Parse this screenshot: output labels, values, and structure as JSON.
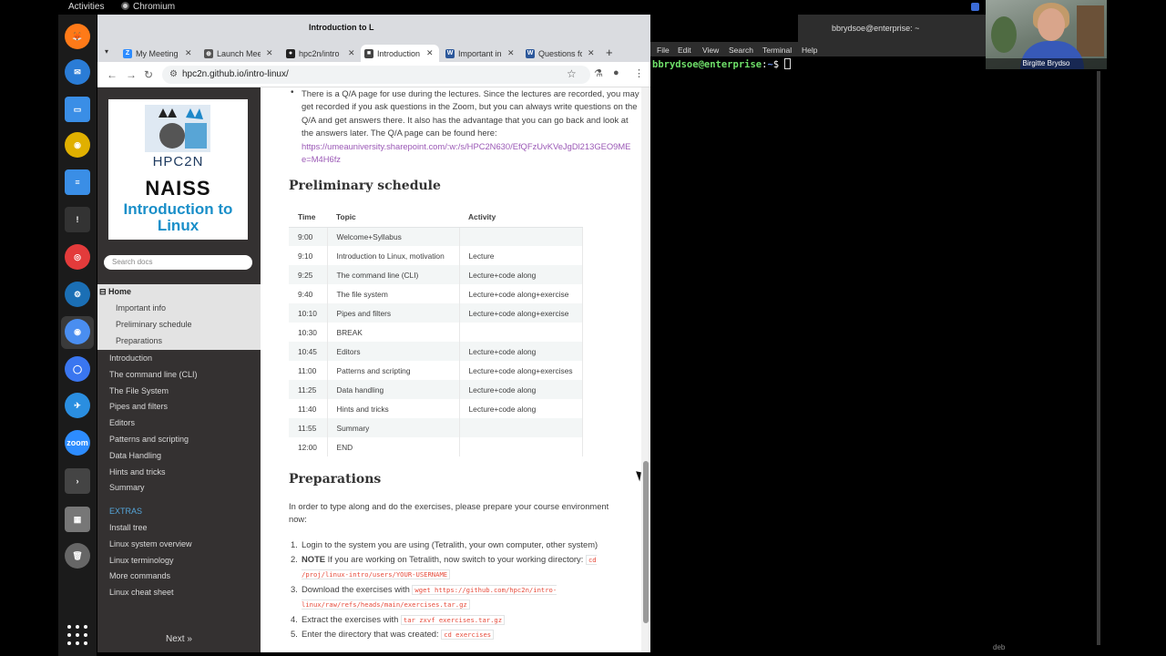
{
  "topbar": {
    "activities": "Activities",
    "app": "Chromium"
  },
  "dock": {
    "items": [
      {
        "name": "firefox-icon",
        "glyph": "🦊",
        "color": "#ff7a18"
      },
      {
        "name": "thunderbird-icon",
        "glyph": "✉",
        "color": "#2a7cd6"
      },
      {
        "name": "text-editor-icon",
        "glyph": "▭",
        "color": "#3a8ee6"
      },
      {
        "name": "rhythmbox-icon",
        "glyph": "◉",
        "color": "#e0b000"
      },
      {
        "name": "writer-icon",
        "glyph": "≡",
        "color": "#3a8ee6"
      },
      {
        "name": "unknown-app-icon",
        "glyph": "!",
        "color": "#333333"
      },
      {
        "name": "help-lifebuoy-icon",
        "glyph": "◎",
        "color": "#e33b3b"
      },
      {
        "name": "steam-icon",
        "glyph": "⚙",
        "color": "#1b6fb5"
      },
      {
        "name": "chromium-icon",
        "glyph": "◉",
        "color": "#4a8ef0"
      },
      {
        "name": "signal-icon",
        "glyph": "◯",
        "color": "#3a76f0"
      },
      {
        "name": "thunderbird-alt-icon",
        "glyph": "✈",
        "color": "#2a8ee0"
      },
      {
        "name": "zoom-icon",
        "glyph": "zoom",
        "color": "#2d8cff"
      },
      {
        "name": "terminal-icon",
        "glyph": "›",
        "color": "#444444"
      },
      {
        "name": "disk-icon",
        "glyph": "▦",
        "color": "#777777"
      },
      {
        "name": "trash-icon",
        "glyph": "🗑",
        "color": "#666666"
      }
    ]
  },
  "browser": {
    "window_title": "Introduction to L",
    "tabs": [
      {
        "label": "My Meeting",
        "icon_color": "#2d8cff",
        "icon": "Z"
      },
      {
        "label": "Launch Mee",
        "icon_color": "#555555",
        "icon": "⊕"
      },
      {
        "label": "hpc2n/intro",
        "icon_color": "#222222",
        "icon": "●"
      },
      {
        "label": "Introduction",
        "icon_color": "#444444",
        "icon": "■"
      },
      {
        "label": "Important in",
        "icon_color": "#2b579a",
        "icon": "W"
      },
      {
        "label": "Questions fo",
        "icon_color": "#2b579a",
        "icon": "W"
      }
    ],
    "url": "hpc2n.github.io/intro-linux/",
    "new_tab": "+"
  },
  "sidebar": {
    "logo": {
      "line1": "HPC2N",
      "line2": "NAISS",
      "line3": "Introduction to Linux"
    },
    "search_placeholder": "Search docs",
    "home": "Home",
    "home_subitems": [
      "Important info",
      "Preliminary schedule",
      "Preparations"
    ],
    "links": [
      "Introduction",
      "The command line (CLI)",
      "The File System",
      "Pipes and filters",
      "Editors",
      "Patterns and scripting",
      "Data Handling",
      "Hints and tricks",
      "Summary"
    ],
    "extras_caption": "EXTRAS",
    "extras": [
      "Install tree",
      "Linux system overview",
      "Linux terminology",
      "More commands",
      "Linux cheat sheet"
    ],
    "next": "Next »"
  },
  "content": {
    "qa_text": "There is a Q/A page for use during the lectures. Since the lectures are recorded, you may get recorded if you ask questions in the Zoom, but you can always write questions on the Q/A and get answers there. It also has the advantage that you can go back and look at the answers later. The Q/A page can be found here:",
    "qa_link": "https://umeauniversity.sharepoint.com/:w:/s/HPC2N630/EfQFzUvKVeJgDl213GEO9ME e=M4H6fz",
    "schedule_title": "Preliminary schedule",
    "schedule_headers": [
      "Time",
      "Topic",
      "Activity"
    ],
    "schedule_rows": [
      [
        "9:00",
        "Welcome+Syllabus",
        ""
      ],
      [
        "9:10",
        "Introduction to Linux, motivation",
        "Lecture"
      ],
      [
        "9:25",
        "The command line (CLI)",
        "Lecture+code along"
      ],
      [
        "9:40",
        "The file system",
        "Lecture+code along+exercise"
      ],
      [
        "10:10",
        "Pipes and filters",
        "Lecture+code along+exercise"
      ],
      [
        "10:30",
        "BREAK",
        ""
      ],
      [
        "10:45",
        "Editors",
        "Lecture+code along"
      ],
      [
        "11:00",
        "Patterns and scripting",
        "Lecture+code along+exercises"
      ],
      [
        "11:25",
        "Data handling",
        "Lecture+code along"
      ],
      [
        "11:40",
        "Hints and tricks",
        "Lecture+code along"
      ],
      [
        "11:55",
        "Summary",
        ""
      ],
      [
        "12:00",
        "END",
        ""
      ]
    ],
    "prep_title": "Preparations",
    "prep_intro": "In order to type along and do the exercises, please prepare your course environment now:",
    "steps": [
      {
        "num": "1.",
        "text": "Login to the system you are using (Tetralith, your own computer, other system)",
        "code": ""
      },
      {
        "num": "2.",
        "bold": "NOTE",
        "text": " If you are working on Tetralith, now switch to your working directory: ",
        "code": "cd /proj/linux-intro/users/YOUR-USERNAME"
      },
      {
        "num": "3.",
        "text": "Download the exercises with ",
        "code": "wget https://github.com/hpc2n/intro-linux/raw/refs/heads/main/exercises.tar.gz"
      },
      {
        "num": "4.",
        "text": "Extract the exercises with ",
        "code": "tar zxvf exercises.tar.gz"
      },
      {
        "num": "5.",
        "text": "Enter the directory that was created: ",
        "code": "cd exercises"
      }
    ]
  },
  "terminal": {
    "title": "bbrydsoe@enterprise: ~",
    "menu": [
      "File",
      "Edit",
      "View",
      "Search",
      "Terminal",
      "Help"
    ],
    "prompt_user": "bbrydsoe@enterprise",
    "prompt_sep": ":",
    "prompt_path": "~",
    "prompt_end": "$ "
  },
  "video": {
    "name": "Birgitte Brydso"
  },
  "footer_text": "deb"
}
